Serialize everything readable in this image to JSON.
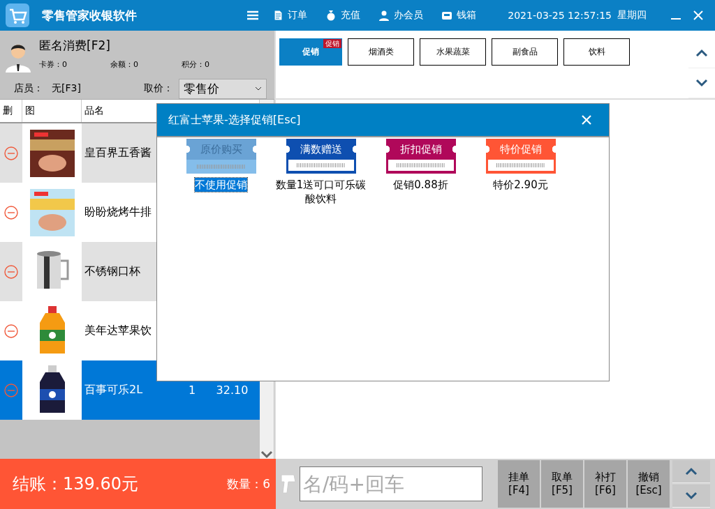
{
  "window": {
    "title": "零售管家收银软件",
    "menu": [
      {
        "label": "订单"
      },
      {
        "label": "充值"
      },
      {
        "label": "办会员"
      },
      {
        "label": "钱箱"
      }
    ],
    "datetime": "2021-03-25 12:57:15",
    "weekday": "星期四"
  },
  "customer": {
    "name": "匿名消费[F2]",
    "stats": [
      {
        "label": "卡券：",
        "value": "0"
      },
      {
        "label": "余额：",
        "value": "0"
      },
      {
        "label": "积分：",
        "value": "0"
      }
    ]
  },
  "staff": {
    "label": "店员：",
    "value": "无[F3]",
    "price_label": "取价：",
    "price_value": "零售价"
  },
  "table": {
    "columns": [
      "删",
      "图",
      "品名"
    ],
    "rows": [
      {
        "name": "皇百界五香酱",
        "selected": false
      },
      {
        "name": "盼盼烧烤牛排",
        "selected": false
      },
      {
        "name": "不锈钢口杯",
        "selected": false
      },
      {
        "name": "美年达苹果饮",
        "selected": false
      },
      {
        "name": "百事可乐2L",
        "qty": "1",
        "amount": "32.10",
        "selected": true
      }
    ]
  },
  "categories": [
    {
      "label": "促销",
      "badge": "促销",
      "selected": true
    },
    {
      "label": "烟酒类",
      "selected": false
    },
    {
      "label": "水果蔬菜",
      "selected": false
    },
    {
      "label": "副食品",
      "selected": false
    },
    {
      "label": "饮料",
      "selected": false
    }
  ],
  "dialog": {
    "title": "红富士苹果-选择促销[Esc]",
    "options": [
      {
        "title": "原价购买",
        "desc": "不使用促销",
        "color": "#6aa3d5",
        "selected": true
      },
      {
        "title": "满数赠送",
        "desc": "数量1送可口可乐碳酸饮料",
        "color": "#0e4fb0",
        "selected": false
      },
      {
        "title": "折扣促销",
        "desc": "促销0.88折",
        "color": "#b0085a",
        "selected": false
      },
      {
        "title": "特价促销",
        "desc": "特价2.90元",
        "color": "#ff5535",
        "selected": false
      }
    ]
  },
  "footer": {
    "total": "结账：139.60元",
    "count": "数量：6",
    "search": {
      "placeholder": "名/码+回车"
    },
    "buttons": [
      {
        "label": "挂单",
        "key": "[F4]"
      },
      {
        "label": "取单",
        "key": "[F5]"
      },
      {
        "label": "补打",
        "key": "[F6]"
      },
      {
        "label": "撤销",
        "key": "[Esc]"
      }
    ]
  }
}
